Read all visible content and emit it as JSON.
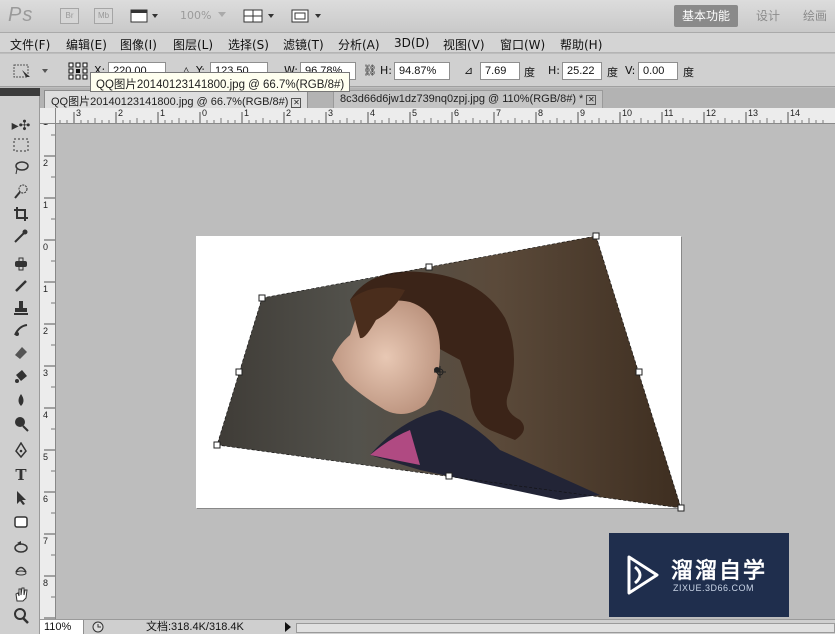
{
  "app": {
    "logo": "Ps",
    "bridge_label": "Br",
    "minibridge_label": "Mb",
    "zoom_dropdown": "100%",
    "workspaces": [
      "基本功能",
      "设计",
      "绘画"
    ]
  },
  "menu": [
    "文件(F)",
    "编辑(E)",
    "图像(I)",
    "图层(L)",
    "选择(S)",
    "滤镜(T)",
    "分析(A)",
    "3D(D)",
    "视图(V)",
    "窗口(W)",
    "帮助(H)"
  ],
  "options": {
    "x_label": "X:",
    "x_value": "220.00 px",
    "y_label": "Y:",
    "y_value": "123.50 px",
    "w_label": "W:",
    "w_value": "96.78%",
    "h_label": "H:",
    "h_value": "94.87%",
    "rotate_value": "7.69",
    "rotate_unit": "度",
    "hskew_label": "H:",
    "hskew_value": "25.22",
    "hskew_unit": "度",
    "vskew_label": "V:",
    "vskew_value": "0.00",
    "vskew_unit": "度"
  },
  "tooltip": "QQ图片20140123141800.jpg @ 66.7%(RGB/8#)",
  "tabs": [
    {
      "label": "QQ图片20140123141800.jpg @ 66.7%(RGB/8#)",
      "active": true
    },
    {
      "label": "8c3d66d6jw1dz739nq0zpj.jpg @ 110%(RGB/8#) *",
      "active": false
    }
  ],
  "ruler": {
    "top": [
      "3",
      "2",
      "1",
      "0",
      "1",
      "2",
      "3",
      "4",
      "5",
      "6",
      "7",
      "8",
      "9",
      "10",
      "11",
      "12",
      "13",
      "14"
    ],
    "left": [
      "1",
      "2",
      "1",
      "0",
      "1",
      "2",
      "3",
      "4",
      "5",
      "6",
      "7",
      "8",
      "9"
    ]
  },
  "status": {
    "zoom": "110%",
    "doc_size": "文档:318.4K/318.4K"
  },
  "watermark": {
    "title": "溜溜自学",
    "subtitle": "ZIXUE.3D66.COM"
  },
  "colors": {
    "app_bg": "#bdbdbd",
    "workspace_active": "#8a8a8a",
    "watermark_bg": "#1f2e4d"
  }
}
